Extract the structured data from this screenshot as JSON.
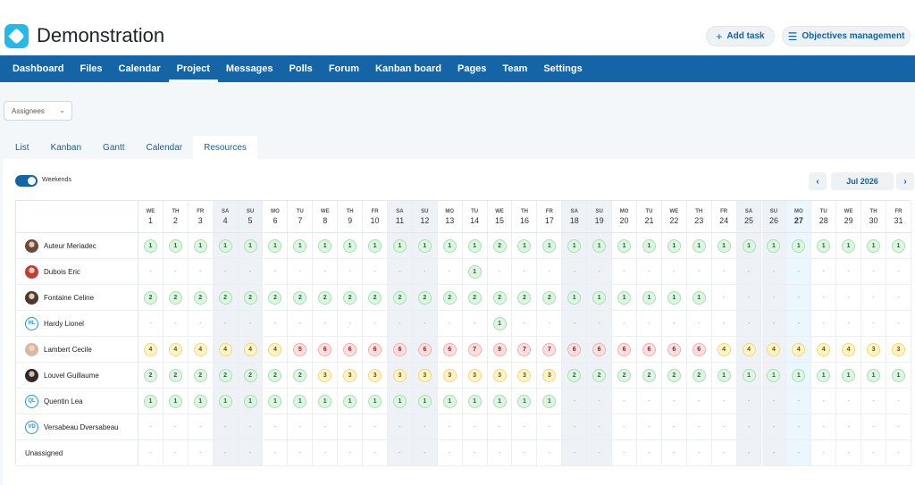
{
  "app": {
    "title": "Demonstration"
  },
  "header": {
    "add_task": "Add task",
    "objectives": "Objectives management",
    "add_icon": "plus-icon",
    "objectives_icon": "list-icon"
  },
  "nav": [
    "Dashboard",
    "Files",
    "Calendar",
    "Project",
    "Messages",
    "Polls",
    "Forum",
    "Kanban board",
    "Pages",
    "Team",
    "Settings"
  ],
  "nav_active": "Project",
  "filter": {
    "label": "Assignees",
    "icon": "chevron-down-icon"
  },
  "subtabs": [
    "List",
    "Kanban",
    "Gantt",
    "Calendar",
    "Resources"
  ],
  "subtab_active": "Resources",
  "weekends_label": "Weekends",
  "month": {
    "label": "Jul 2026",
    "prev_icon": "chevron-left-icon",
    "next_icon": "chevron-right-icon"
  },
  "colors": {
    "primary": "#1565a6",
    "green": "#dff5e3",
    "yellow": "#fff3c8",
    "red": "#fbe0e0"
  },
  "days": [
    {
      "dw": "WE",
      "dn": "1"
    },
    {
      "dw": "TH",
      "dn": "2"
    },
    {
      "dw": "FR",
      "dn": "3"
    },
    {
      "dw": "SA",
      "dn": "4"
    },
    {
      "dw": "SU",
      "dn": "5"
    },
    {
      "dw": "MO",
      "dn": "6"
    },
    {
      "dw": "TU",
      "dn": "7"
    },
    {
      "dw": "WE",
      "dn": "8"
    },
    {
      "dw": "TH",
      "dn": "9"
    },
    {
      "dw": "FR",
      "dn": "10"
    },
    {
      "dw": "SA",
      "dn": "11"
    },
    {
      "dw": "SU",
      "dn": "12"
    },
    {
      "dw": "MO",
      "dn": "13"
    },
    {
      "dw": "TU",
      "dn": "14"
    },
    {
      "dw": "WE",
      "dn": "15"
    },
    {
      "dw": "TH",
      "dn": "16"
    },
    {
      "dw": "FR",
      "dn": "17"
    },
    {
      "dw": "SA",
      "dn": "18"
    },
    {
      "dw": "SU",
      "dn": "19"
    },
    {
      "dw": "MO",
      "dn": "20"
    },
    {
      "dw": "TU",
      "dn": "21"
    },
    {
      "dw": "WE",
      "dn": "22"
    },
    {
      "dw": "TH",
      "dn": "23"
    },
    {
      "dw": "FR",
      "dn": "24"
    },
    {
      "dw": "SA",
      "dn": "25"
    },
    {
      "dw": "SU",
      "dn": "26"
    },
    {
      "dw": "MO",
      "dn": "27"
    },
    {
      "dw": "TU",
      "dn": "28"
    },
    {
      "dw": "WE",
      "dn": "29"
    },
    {
      "dw": "TH",
      "dn": "30"
    },
    {
      "dw": "FR",
      "dn": "31"
    }
  ],
  "today_index": 26,
  "rows": [
    {
      "name": "Auteur Meriadec",
      "avatar": "photo",
      "initials": "",
      "values": [
        "1",
        "1",
        "1",
        "1",
        "1",
        "1",
        "1",
        "1",
        "1",
        "1",
        "1",
        "1",
        "1",
        "1",
        "2",
        "1",
        "1",
        "1",
        "1",
        "1",
        "1",
        "1",
        "1",
        "1",
        "1",
        "1",
        "1",
        "1",
        "1",
        "1",
        "1"
      ]
    },
    {
      "name": "Dubois Eric",
      "avatar": "photo2",
      "initials": "",
      "values": [
        "-",
        "-",
        "-",
        "-",
        "-",
        "-",
        "-",
        "-",
        "-",
        "-",
        "-",
        "-",
        "-",
        "1",
        "-",
        "-",
        "-",
        "-",
        "-",
        "-",
        "-",
        "-",
        "-",
        "-",
        "-",
        "-",
        "-",
        "-",
        "-",
        "-",
        "-"
      ]
    },
    {
      "name": "Fontaine Celine",
      "avatar": "photo3",
      "initials": "",
      "values": [
        "2",
        "2",
        "2",
        "2",
        "2",
        "2",
        "2",
        "2",
        "2",
        "2",
        "2",
        "2",
        "2",
        "2",
        "2",
        "2",
        "2",
        "1",
        "1",
        "1",
        "1",
        "1",
        "1",
        "-",
        "-",
        "-",
        "-",
        "-",
        "-",
        "-",
        "-"
      ]
    },
    {
      "name": "Hardy Lionel",
      "avatar": "initials",
      "initials": "HL",
      "values": [
        "-",
        "-",
        "-",
        "-",
        "-",
        "-",
        "-",
        "-",
        "-",
        "-",
        "-",
        "-",
        "-",
        "-",
        "1",
        "-",
        "-",
        "-",
        "-",
        "-",
        "-",
        "-",
        "-",
        "-",
        "-",
        "-",
        "-",
        "-",
        "-",
        "-",
        "-"
      ]
    },
    {
      "name": "Lambert Cecile",
      "avatar": "photo4",
      "initials": "",
      "values": [
        "4",
        "4",
        "4",
        "4",
        "4",
        "4",
        "5",
        "6",
        "6",
        "6",
        "6",
        "6",
        "6",
        "7",
        "9",
        "7",
        "7",
        "6",
        "6",
        "6",
        "6",
        "6",
        "6",
        "4",
        "4",
        "4",
        "4",
        "4",
        "4",
        "3",
        "3"
      ]
    },
    {
      "name": "Louvel Guillaume",
      "avatar": "photo5",
      "initials": "",
      "values": [
        "2",
        "2",
        "2",
        "2",
        "2",
        "2",
        "2",
        "3",
        "3",
        "3",
        "3",
        "3",
        "3",
        "3",
        "3",
        "3",
        "3",
        "2",
        "2",
        "2",
        "2",
        "2",
        "2",
        "1",
        "1",
        "1",
        "1",
        "1",
        "1",
        "1",
        "1"
      ]
    },
    {
      "name": "Quentin Lea",
      "avatar": "initials",
      "initials": "QL",
      "values": [
        "1",
        "1",
        "1",
        "1",
        "1",
        "1",
        "1",
        "1",
        "1",
        "1",
        "1",
        "1",
        "1",
        "1",
        "1",
        "1",
        "1",
        "-",
        "-",
        "-",
        "-",
        "-",
        "-",
        "-",
        "-",
        "-",
        "-",
        "-",
        "-",
        "-",
        "-"
      ]
    },
    {
      "name": "Versabeau Dversabeau",
      "avatar": "initials",
      "initials": "VD",
      "values": [
        "-",
        "-",
        "-",
        "-",
        "-",
        "-",
        "-",
        "-",
        "-",
        "-",
        "-",
        "-",
        "-",
        "-",
        "-",
        "-",
        "-",
        "-",
        "-",
        "-",
        "-",
        "-",
        "-",
        "-",
        "-",
        "-",
        "-",
        "-",
        "-",
        "-",
        "-"
      ]
    },
    {
      "name": "Unassigned",
      "avatar": "none",
      "initials": "",
      "values": [
        "-",
        "-",
        "-",
        "-",
        "-",
        "-",
        "-",
        "-",
        "-",
        "-",
        "-",
        "-",
        "-",
        "-",
        "-",
        "-",
        "-",
        "-",
        "-",
        "-",
        "-",
        "-",
        "-",
        "-",
        "-",
        "-",
        "-",
        "-",
        "-",
        "-",
        "-"
      ]
    }
  ]
}
